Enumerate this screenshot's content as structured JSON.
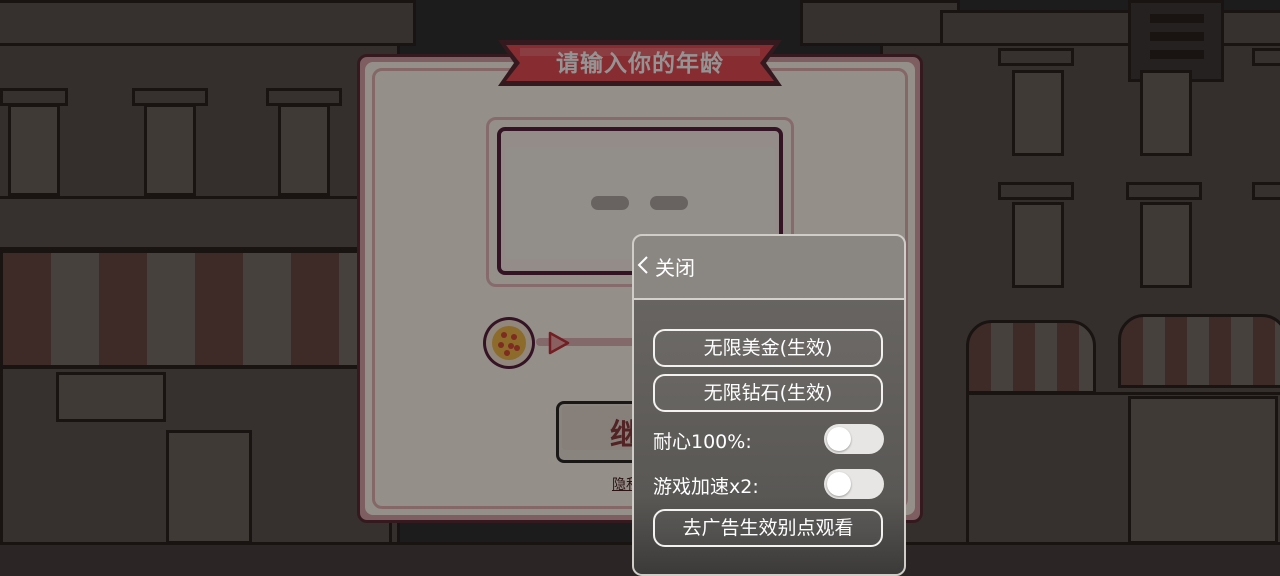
{
  "dialog": {
    "title": "请输入你的年龄",
    "continue_label": "继续",
    "privacy_link": "隐私政"
  },
  "cheat_menu": {
    "close_label": "关闭",
    "buttons": [
      {
        "label": "无限美金(生效)"
      },
      {
        "label": "无限钻石(生效)"
      }
    ],
    "toggles": [
      {
        "label": "耐心100%:",
        "on": false
      },
      {
        "label": "游戏加速x2:",
        "on": false
      }
    ],
    "ad_button": {
      "label": "去广告生效别点观看"
    }
  },
  "icons": [
    "pizza-icon",
    "play-arrow-icon",
    "chevron-left-icon"
  ],
  "colors": {
    "ribbon": "#e84d55",
    "dialog_bg": "#fff7ec",
    "input_border": "#5b2240",
    "continue_text": "#8e3c3e",
    "panel_overlay": "#6b6865"
  }
}
